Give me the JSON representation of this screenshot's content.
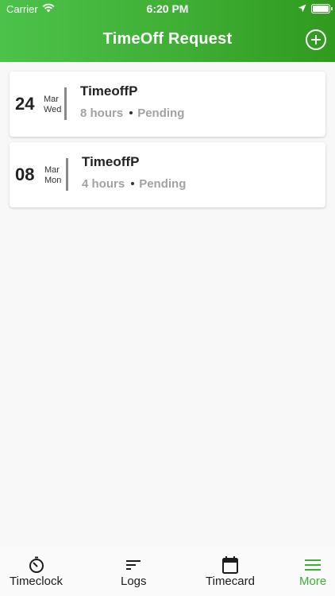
{
  "status_bar": {
    "carrier": "Carrier",
    "time": "6:20 PM"
  },
  "header": {
    "title": "TimeOff Request",
    "add_icon": "plus-circle-icon",
    "brand_color": "#3fae34"
  },
  "requests": [
    {
      "day": "24",
      "month": "Mar",
      "weekday": "Wed",
      "title": "TimeoffP",
      "hours": "8 hours",
      "status": "Pending"
    },
    {
      "day": "08",
      "month": "Mar",
      "weekday": "Mon",
      "title": "TimeoffP",
      "hours": "4 hours",
      "status": "Pending"
    }
  ],
  "tabbar": {
    "active": "more",
    "active_color": "#3fae34",
    "items": [
      {
        "label": "Timeclock",
        "icon": "timer-icon"
      },
      {
        "label": "Logs",
        "icon": "sort-lines-icon"
      },
      {
        "label": "Timecard",
        "icon": "calendar-icon"
      },
      {
        "label": "More",
        "icon": "menu-icon"
      }
    ]
  }
}
